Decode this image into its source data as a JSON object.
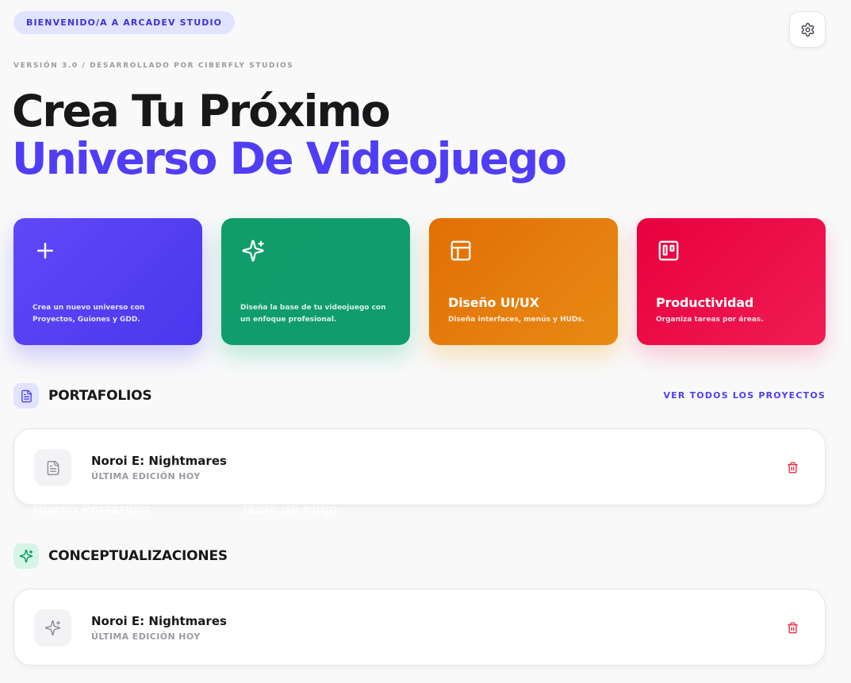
{
  "header": {
    "welcome": "BIENVENIDO/A A ARCADEV STUDIO",
    "version": "VERSIÓN 3.0 / DESARROLLADO POR CIBERFLY STUDIOS",
    "settings_icon": "gear-icon"
  },
  "hero": {
    "line1": "Crea Tu Próximo",
    "line2": "Universo De Videojuego"
  },
  "cards": [
    {
      "title": "Nuevo Portafolio",
      "desc": "Crea un nuevo universo con Proyectos, Guiones y GDD.",
      "icon": "plus-icon",
      "color": "#4f3ef5"
    },
    {
      "title": "Tabla de Flujo",
      "desc": "Diseña la base de tu videojuego con un enfoque profesional.",
      "icon": "sparkles-icon",
      "color": "#059669"
    },
    {
      "title": "Diseño UI/UX",
      "desc": "Diseña interfaces, menús y HUDs.",
      "icon": "layout-icon",
      "color": "#e26f05"
    },
    {
      "title": "Productividad",
      "desc": "Organiza tareas por áreas.",
      "icon": "kanban-icon",
      "color": "#ea0040"
    }
  ],
  "sections": {
    "portfolios": {
      "title": "PORTAFOLIOS",
      "view_all": "VER TODOS LOS PROYECTOS",
      "items": [
        {
          "name": "Noroi E: Nightmares",
          "meta": "ÚLTIMA EDICIÓN HOY"
        }
      ]
    },
    "concepts": {
      "title": "CONCEPTUALIZACIONES",
      "items": [
        {
          "name": "Noroi E: Nightmares",
          "meta": "ÚLTIMA EDICIÓN HOY"
        }
      ]
    }
  },
  "colors": {
    "accent": "#4f3ef5",
    "delete": "#e11d2e"
  }
}
